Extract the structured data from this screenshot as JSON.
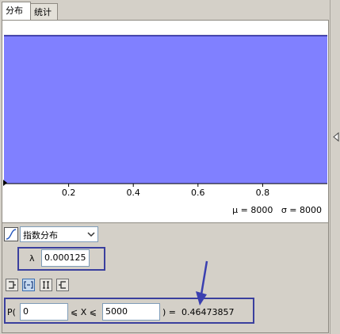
{
  "tabs": [
    {
      "label": "分布"
    },
    {
      "label": "统计"
    }
  ],
  "chart_data": {
    "type": "area",
    "x_ticks": [
      0.2,
      0.4,
      0.6,
      0.8
    ],
    "fill_color": "#8080ff",
    "line_color": "#0000ff",
    "stats_text": "μ = 8000   σ = 8000"
  },
  "controls": {
    "distribution_label": "指数分布",
    "lambda_symbol": "λ",
    "lambda_value": "0.000125",
    "prob_prefix": "P(",
    "lower_value": "0",
    "ineq_text": "⩽ X ⩽",
    "upper_value": "5000",
    "result_text": ") =  0.46473857"
  },
  "icons": [
    "left-sided-icon",
    "interval-icon",
    "two-tailed-icon",
    "right-sided-icon"
  ]
}
